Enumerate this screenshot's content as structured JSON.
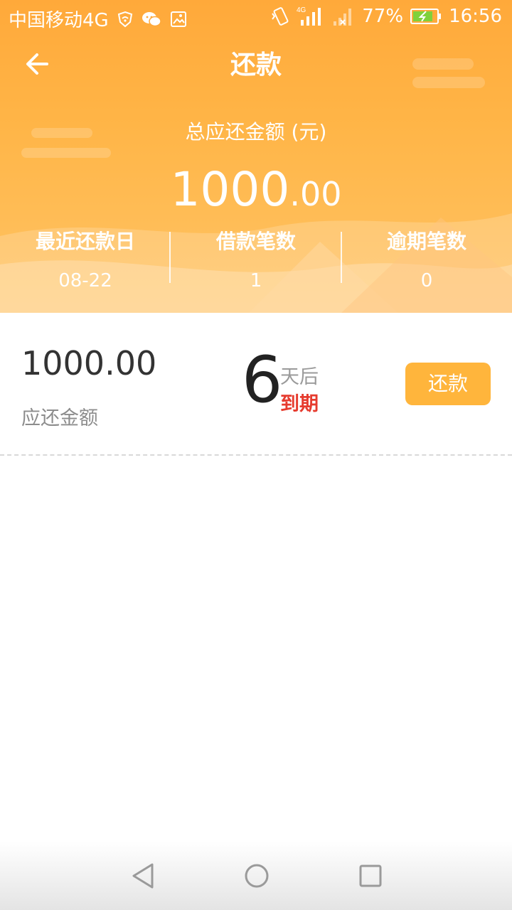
{
  "status_bar": {
    "carrier": "中国移动4G",
    "battery": "77%",
    "time": "16:56",
    "icons_left": [
      "shield-wifi-icon",
      "wechat-icon",
      "image-icon"
    ],
    "icons_right": [
      "vibrate-icon",
      "signal-4g-icon",
      "signal-empty-icon",
      "battery-charging-icon"
    ]
  },
  "header": {
    "title": "还款",
    "back_icon": "arrow-left-icon",
    "total_label": "总应还金额 (元)",
    "total_amount_int": "1000",
    "total_amount_dec": ".00",
    "stats": [
      {
        "label": "最近还款日",
        "value": "08-22"
      },
      {
        "label": "借款笔数",
        "value": "1"
      },
      {
        "label": "逾期笔数",
        "value": "0"
      }
    ]
  },
  "loan": {
    "amount": "1000.00",
    "amount_label": "应还金额",
    "days": "6",
    "days_suffix": "天后",
    "due_text": "到期",
    "button_label": "还款"
  },
  "colors": {
    "header_top": "#ffa93a",
    "header_bottom": "#ffc465",
    "button": "#ffb53c",
    "due_red": "#e63b2e"
  },
  "nav": {
    "icons": [
      "back-triangle-icon",
      "home-circle-icon",
      "recent-square-icon"
    ]
  }
}
